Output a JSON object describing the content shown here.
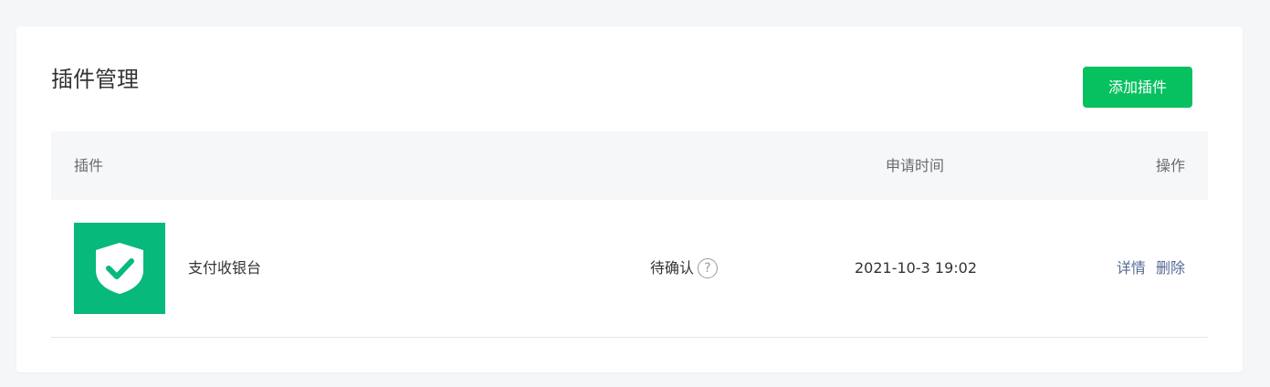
{
  "header": {
    "title": "插件管理",
    "add_button_label": "添加插件"
  },
  "table": {
    "columns": {
      "plugin": "插件",
      "apply_time": "申请时间",
      "actions": "操作"
    },
    "rows": [
      {
        "logo_icon": "shield-check-icon",
        "logo_color": "#07b97a",
        "name": "支付收银台",
        "status": "待确认",
        "apply_time": "2021-10-3 19:02",
        "actions": {
          "detail": "详情",
          "delete": "删除"
        }
      }
    ]
  },
  "colors": {
    "primary_button": "#07c160",
    "link": "#576b95",
    "header_bg": "#f6f7f9"
  }
}
